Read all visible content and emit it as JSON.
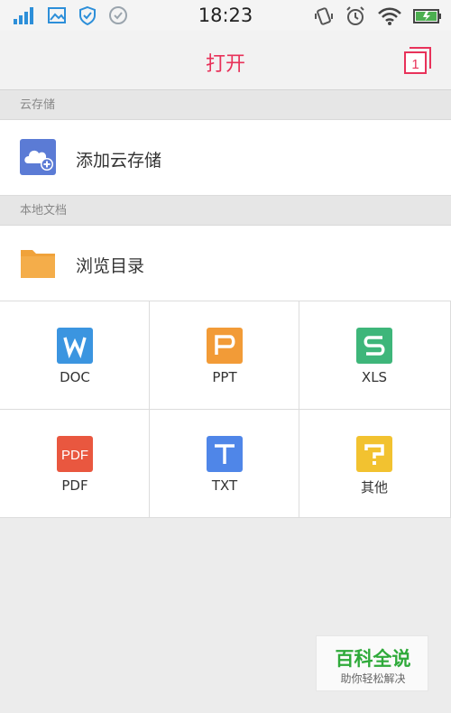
{
  "status_bar": {
    "time": "18:23",
    "left_icons": [
      "signal-icon",
      "image-icon",
      "shield-icon",
      "check-icon"
    ],
    "right_icons": [
      "vibrate-icon",
      "alarm-icon",
      "wifi-icon",
      "battery-icon"
    ],
    "colors": {
      "signal": "#2d8fd9",
      "battery": "#4caf50"
    }
  },
  "header": {
    "title": "打开",
    "tabs_count": "1",
    "accent": "#e8325a"
  },
  "cloud_section": {
    "label": "云存储",
    "item_label": "添加云存储",
    "icon": "cloud-add-icon",
    "icon_color": "#5b7bd5"
  },
  "local_section": {
    "label": "本地文档",
    "item_label": "浏览目录",
    "icon": "folder-icon",
    "icon_color": "#f0a23a"
  },
  "file_types": [
    {
      "label": "DOC",
      "glyph": "W",
      "color": "#3b95e0"
    },
    {
      "label": "PPT",
      "glyph": "P",
      "color": "#f29b37"
    },
    {
      "label": "XLS",
      "glyph": "S",
      "color": "#3eb67a"
    },
    {
      "label": "PDF",
      "glyph": "PDF",
      "color": "#e9573f"
    },
    {
      "label": "TXT",
      "glyph": "T",
      "color": "#4f86e8"
    },
    {
      "label": "其他",
      "glyph": "?",
      "color": "#f2c230"
    }
  ],
  "watermark": {
    "title": "百科全说",
    "subtitle": "助你轻松解决"
  }
}
